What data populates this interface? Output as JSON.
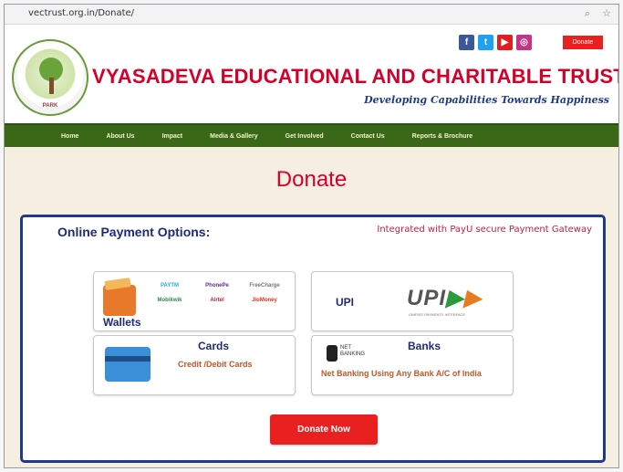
{
  "browser": {
    "url": "vectrust.org.in/Donate/",
    "zoom_icon": "magnifier-icon",
    "bookmark_icon": "star-icon"
  },
  "header": {
    "logo_text": "VYASADEVA EDUCATIONAL AND CHARITABLE TRUST",
    "logo_bottom_text": "PARK",
    "trust_name_part1": "VYASADEVA",
    "trust_name_part2": "EDUCATIONAL AND CHARITABLE TRUST",
    "tagline": "Developing Capabilities Towards Happiness",
    "social": [
      {
        "name": "facebook-icon",
        "glyph": "f"
      },
      {
        "name": "twitter-icon",
        "glyph": "t"
      },
      {
        "name": "youtube-icon",
        "glyph": "▶"
      },
      {
        "name": "instagram-icon",
        "glyph": "◎"
      }
    ],
    "donate_label": "Donate"
  },
  "nav": {
    "items": [
      "Home",
      "About Us",
      "Impact",
      "Media & Gallery",
      "Get Involved",
      "Contact Us",
      "Reports & Brochure"
    ]
  },
  "main": {
    "title": "Donate",
    "panel_title": "Online Payment Options:",
    "gateway_note": "Integrated with PayU secure Payment Gateway",
    "wallets": {
      "label": "Wallets",
      "brands": [
        "PAYTM",
        "PhonePe",
        "FreeCharge",
        "Mobikwik",
        "Airtel",
        "JioMoney"
      ]
    },
    "upi": {
      "label": "UPI",
      "logo": "UPI",
      "sub": "UNIFIED PAYMENTS INTERFACE"
    },
    "cards": {
      "label": "Cards",
      "sub": "Credit /Debit Cards"
    },
    "banks": {
      "label": "Banks",
      "icon_text_1": "NET",
      "icon_text_2": "BANKING",
      "sub": "Net Banking Using Any Bank A/C of India"
    },
    "donate_now": "Donate Now"
  },
  "colors": {
    "brand_red": "#d4002a",
    "brand_blue": "#1f3a8a",
    "nav_green": "#3a6817",
    "button_red": "#e82020",
    "page_bg": "#f6eee1"
  }
}
